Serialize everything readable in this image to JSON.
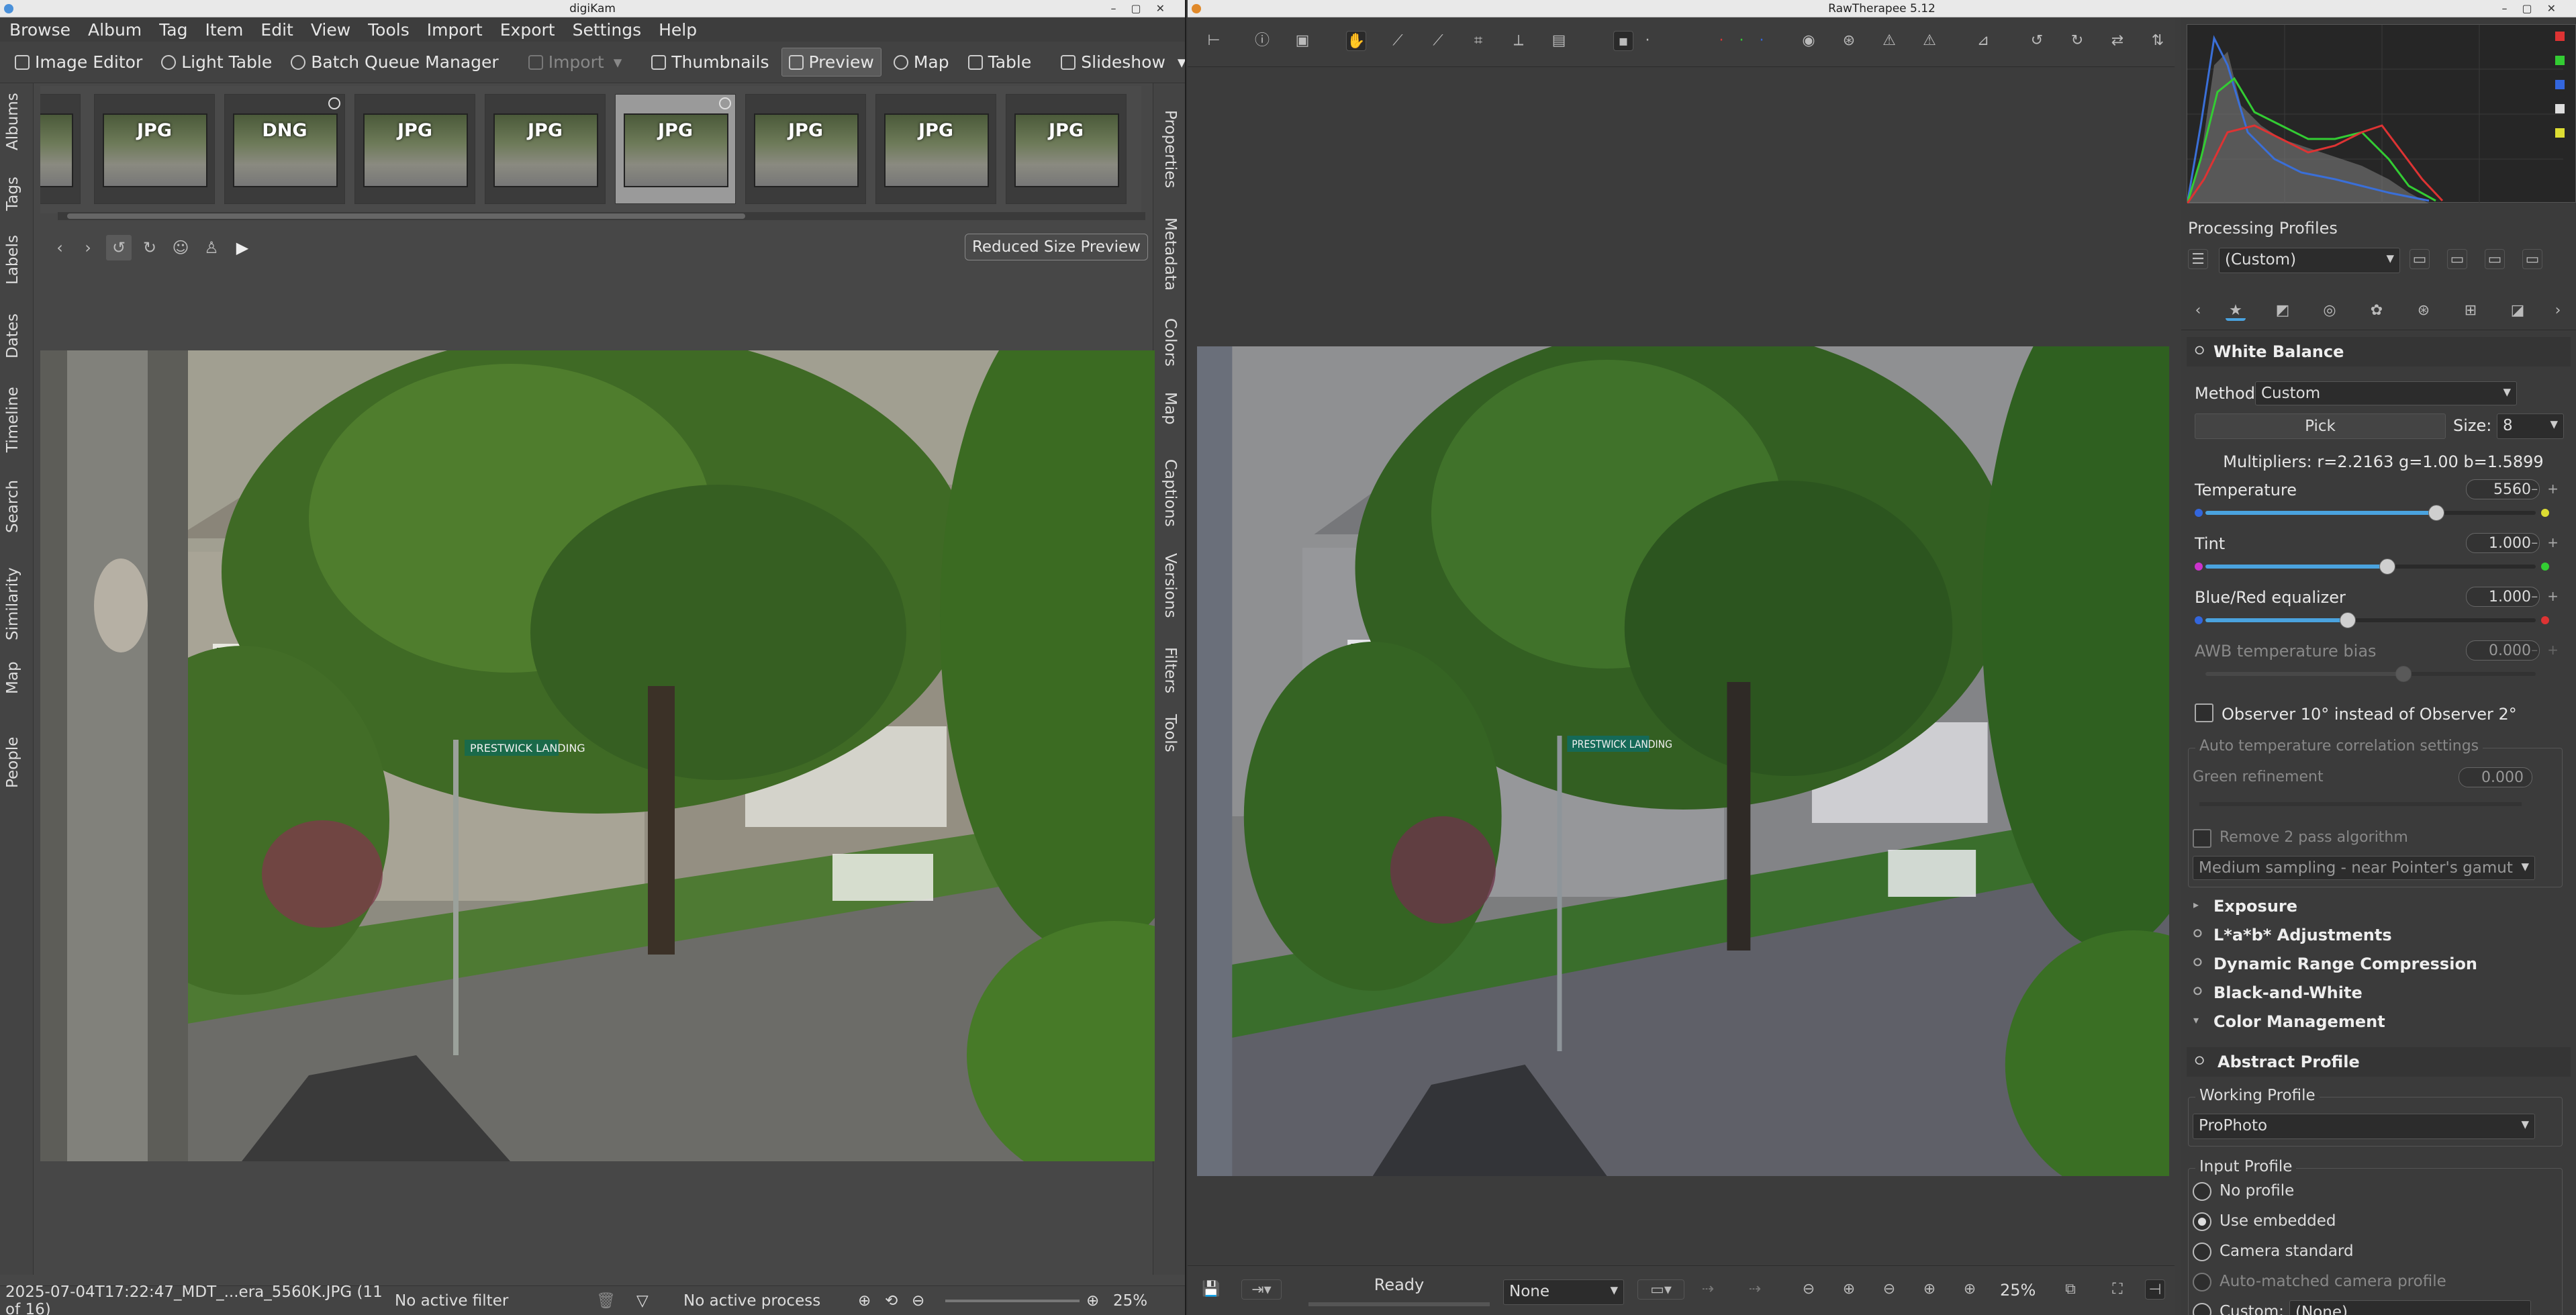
{
  "digikam": {
    "title": "digiKam",
    "menu": [
      "Browse",
      "Album",
      "Tag",
      "Item",
      "Edit",
      "View",
      "Tools",
      "Import",
      "Export",
      "Settings",
      "Help"
    ],
    "toolbar": {
      "image_editor": "Image Editor",
      "light_table": "Light Table",
      "batch_queue": "Batch Queue Manager",
      "import": "Import",
      "thumbnails": "Thumbnails",
      "preview": "Preview",
      "map": "Map",
      "table": "Table",
      "slideshow": "Slideshow"
    },
    "left_tabs": [
      "Albums",
      "Tags",
      "Labels",
      "Dates",
      "Timeline",
      "Search",
      "Similarity",
      "Map",
      "People"
    ],
    "right_tabs": [
      "Properties",
      "Metadata",
      "Colors",
      "Map",
      "Captions",
      "Versions",
      "Filters",
      "Tools"
    ],
    "thumbnails": [
      "",
      "JPG",
      "DNG",
      "JPG",
      "JPG",
      "JPG",
      "JPG",
      "JPG",
      "JPG"
    ],
    "reduced_preview": "Reduced Size Preview",
    "status": {
      "filename": "2025-07-04T17:22:47_MDT_...era_5560K.JPG (11 of 16)",
      "filter": "No active filter",
      "process": "No active process",
      "zoom": "25%"
    }
  },
  "photo": {
    "sign_text": "PRESTWICK LANDING"
  },
  "rawtherapee": {
    "title": "RawTherapee 5.12",
    "status": "Ready",
    "bottom_combo": "None",
    "zoom": "25%",
    "processing_profiles_label": "Processing Profiles",
    "profile": "(Custom)",
    "white_balance": {
      "title": "White Balance",
      "method_label": "Method:",
      "method_value": "Custom",
      "pick_label": "Pick",
      "size_label": "Size:",
      "size_value": "8",
      "multipliers": "Multipliers: r=2.2163 g=1.00 b=1.5899",
      "temperature_label": "Temperature",
      "temperature_value": "5560",
      "temperature_pos": 0.7,
      "tint_label": "Tint",
      "tint_value": "1.000",
      "tint_pos": 0.55,
      "bluered_label": "Blue/Red equalizer",
      "bluered_value": "1.000",
      "bluered_pos": 0.43,
      "awb_label": "AWB temperature bias",
      "awb_value": "0.000",
      "awb_pos": 0.6,
      "observer_label": "Observer 10° instead of Observer 2°",
      "auto_settings_label": "Auto temperature correlation settings",
      "green_refinement_label": "Green refinement",
      "green_refinement_value": "0.000",
      "remove_2pass_label": "Remove 2 pass algorithm",
      "sampling_value": "Medium sampling - near Pointer's gamut"
    },
    "sections": [
      "Exposure",
      "L*a*b* Adjustments",
      "Dynamic Range Compression",
      "Black-and-White",
      "Color Management"
    ],
    "color_management": {
      "abstract_profile": "Abstract Profile",
      "working_profile_label": "Working Profile",
      "working_profile_value": "ProPhoto",
      "input_profile_label": "Input Profile",
      "input_options": [
        "No profile",
        "Use embedded",
        "Camera standard",
        "Auto-matched camera profile",
        "Custom:"
      ],
      "custom_value": "(None)"
    }
  },
  "colors": {
    "accent": "#4aa3df",
    "selected_thumb": "#9a9a9a",
    "panel_bg": "#3b3b3b"
  }
}
